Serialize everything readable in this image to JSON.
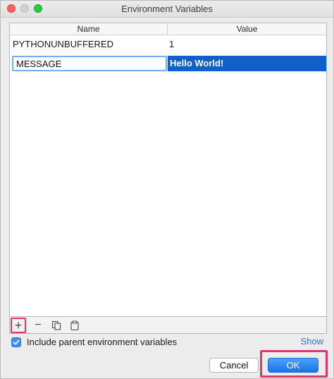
{
  "window": {
    "title": "Environment Variables"
  },
  "table": {
    "columns": [
      "Name",
      "Value"
    ],
    "rows": [
      {
        "name": "PYTHONUNBUFFERED",
        "value": "1"
      },
      {
        "name": "MESSAGE",
        "value": "Hello World!"
      }
    ]
  },
  "toolbar": {
    "add_label": "+",
    "remove_label": "−",
    "icons": [
      "plus-icon",
      "minus-icon",
      "copy-icon",
      "paste-icon"
    ]
  },
  "include_parent": {
    "checked": true,
    "label": "Include parent environment variables"
  },
  "show_link": "Show",
  "buttons": {
    "cancel": "Cancel",
    "ok": "OK"
  },
  "colors": {
    "selection": "#1160c9",
    "accent": "#3b8ef0",
    "highlight": "#e0346f",
    "link": "#2f6fd6"
  }
}
